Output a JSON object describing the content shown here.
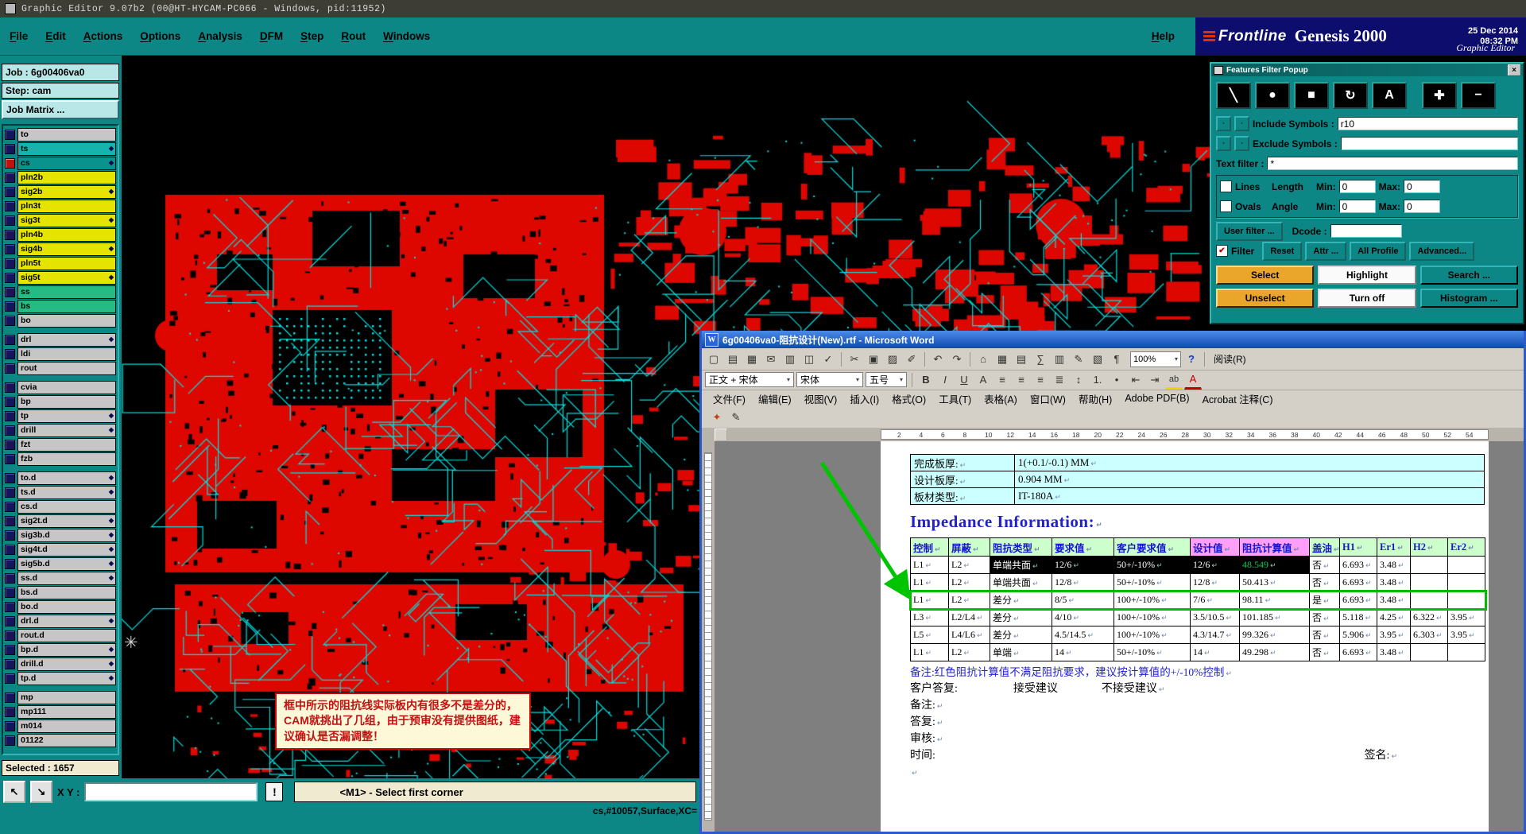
{
  "window": {
    "title": "Graphic Editor 9.07b2 (00@HT-HYCAM-PC066 - Windows, pid:11952)"
  },
  "menu": {
    "items": [
      "File",
      "Edit",
      "Actions",
      "Options",
      "Analysis",
      "DFM",
      "Step",
      "Rout",
      "Windows"
    ],
    "help": "Help"
  },
  "brand": {
    "logo": "Frontline",
    "product": "Genesis 2000",
    "date": "25 Dec 2014",
    "time": "08:32 PM",
    "subtitle": "Graphic Editor"
  },
  "pcb": {
    "origin_glyph": "✳"
  },
  "canvas_note": {
    "text": "框中所示的阻抗线实际板内有很多不是差分的，CAM就挑出了几组，由于预审没有提供图纸，建议确认是否漏调整！"
  },
  "sidebar": {
    "job_label": "Job : 6g00406va0",
    "step_label": "Step: cam",
    "matrix_button": "Job Matrix ...",
    "selected_label": "Selected : 1657",
    "marker_glyph": "◆",
    "layers": [
      {
        "name": "to",
        "color": "silver"
      },
      {
        "name": "ts",
        "color": "teal",
        "marker": true
      },
      {
        "name": "cs",
        "color": "dteal",
        "marker": true,
        "active": true
      },
      {
        "name": "pln2b",
        "color": "yellow"
      },
      {
        "name": "sig2b",
        "color": "yellow",
        "marker": true
      },
      {
        "name": "pln3t",
        "color": "yellow"
      },
      {
        "name": "sig3t",
        "color": "yellow",
        "marker": true
      },
      {
        "name": "pln4b",
        "color": "yellow"
      },
      {
        "name": "sig4b",
        "color": "yellow",
        "marker": true
      },
      {
        "name": "pln5t",
        "color": "yellow"
      },
      {
        "name": "sig5t",
        "color": "yellow",
        "marker": true
      },
      {
        "name": "ss",
        "color": "green"
      },
      {
        "name": "bs",
        "color": "green"
      },
      {
        "name": "bo",
        "color": "silver"
      },
      {
        "name": "drl",
        "color": "silver",
        "marker": true,
        "gap": true
      },
      {
        "name": "ldi",
        "color": "silver"
      },
      {
        "name": "rout",
        "color": "silver"
      },
      {
        "name": "cvia",
        "color": "silver",
        "gap": true
      },
      {
        "name": "bp",
        "color": "silver"
      },
      {
        "name": "tp",
        "color": "silver",
        "marker": true
      },
      {
        "name": "drill",
        "color": "silver",
        "marker": true
      },
      {
        "name": "fzt",
        "color": "silver"
      },
      {
        "name": "fzb",
        "color": "silver"
      },
      {
        "name": "to.d",
        "color": "silver",
        "marker": true,
        "gap": true
      },
      {
        "name": "ts.d",
        "color": "silver",
        "marker": true
      },
      {
        "name": "cs.d",
        "color": "silver"
      },
      {
        "name": "sig2t.d",
        "color": "silver",
        "marker": true
      },
      {
        "name": "sig3b.d",
        "color": "silver",
        "marker": true
      },
      {
        "name": "sig4t.d",
        "color": "silver",
        "marker": true
      },
      {
        "name": "sig5b.d",
        "color": "silver",
        "marker": true
      },
      {
        "name": "ss.d",
        "color": "silver",
        "marker": true
      },
      {
        "name": "bs.d",
        "color": "silver"
      },
      {
        "name": "bo.d",
        "color": "silver"
      },
      {
        "name": "drl.d",
        "color": "silver",
        "marker": true
      },
      {
        "name": "rout.d",
        "color": "silver"
      },
      {
        "name": "bp.d",
        "color": "silver",
        "marker": true
      },
      {
        "name": "drill.d",
        "color": "silver",
        "marker": true
      },
      {
        "name": "tp.d",
        "color": "silver",
        "marker": true
      },
      {
        "name": "mp",
        "color": "silver",
        "gap": true
      },
      {
        "name": "mp111",
        "color": "silver"
      },
      {
        "name": "m014",
        "color": "silver"
      },
      {
        "name": "01122",
        "color": "silver"
      }
    ]
  },
  "statusbar": {
    "xy_label": "X Y :",
    "xy_value": "",
    "alarm_label": "!",
    "prompt": "<M1> - Select first corner",
    "info": "cs,#10057,Surface,XC=",
    "pan_buttons": [
      {
        "name": "pan-up-left-button",
        "glyph": "↖"
      },
      {
        "name": "pan-down-right-button",
        "glyph": "↘"
      }
    ]
  },
  "ui": {
    "dropdown_arrow": "▾",
    "check_glyph": "✔",
    "close_glyph": "×",
    "word_icon": "W",
    "help_glyph": "?",
    "picker_glyph": "▪"
  },
  "filter_popup": {
    "title": "Features Filter Popup",
    "feature_buttons": [
      {
        "name": "line-feature-button",
        "glyph": "╲"
      },
      {
        "name": "pad-feature-button",
        "glyph": "●"
      },
      {
        "name": "surface-feature-button",
        "glyph": "■"
      },
      {
        "name": "arc-feature-button",
        "glyph": "↻"
      },
      {
        "name": "text-feature-button",
        "glyph": "A"
      },
      {
        "name": "positive-feature-button",
        "glyph": "✚"
      },
      {
        "name": "negative-feature-button",
        "glyph": "−"
      }
    ],
    "include_label": "Include Symbols :",
    "include_value": "r10",
    "exclude_label": "Exclude Symbols :",
    "exclude_value": "",
    "text_filter_label": "Text filter :",
    "text_filter_value": "*",
    "lines_label": "Lines",
    "length_label": "Length",
    "ovals_label": "Ovals",
    "angle_label": "Angle",
    "min_label": "Min:",
    "max_label": "Max:",
    "length_min": "0",
    "length_max": "0",
    "angle_min": "0",
    "angle_max": "0",
    "user_filter_button": "User filter ...",
    "dcode_label": "Dcode :",
    "dcode_value": "",
    "filter_check_label": "Filter",
    "reset_button": "Reset",
    "attr_button": "Attr ...",
    "profile_button": "All Profile",
    "advanced_button": "Advanced...",
    "select_button": "Select",
    "highlight_button": "Highlight",
    "search_button": "Search ...",
    "unselect_button": "Unselect",
    "turnoff_button": "Turn off",
    "histogram_button": "Histogram ..."
  },
  "word": {
    "title": "6g00406va0-阻抗设计(New).rtf - Microsoft Word",
    "zoom": "100%",
    "read_button": "阅读(R)",
    "font_style": "正文 + 宋体",
    "font_name": "宋体",
    "font_size": "五号",
    "menus": [
      {
        "label": "文件(F)",
        "key": "file"
      },
      {
        "label": "编辑(E)",
        "key": "edit"
      },
      {
        "label": "视图(V)",
        "key": "view"
      },
      {
        "label": "插入(I)",
        "key": "insert"
      },
      {
        "label": "格式(O)",
        "key": "format"
      },
      {
        "label": "工具(T)",
        "key": "tools"
      },
      {
        "label": "表格(A)",
        "key": "table"
      },
      {
        "label": "窗口(W)",
        "key": "window"
      },
      {
        "label": "帮助(H)",
        "key": "help"
      },
      {
        "label": "Adobe PDF(B)",
        "key": "adobe-pdf"
      },
      {
        "label": "Acrobat 注释(C)",
        "key": "acrobat-comments"
      }
    ],
    "toolbar1": [
      {
        "name": "new-document-icon",
        "glyph": "▢"
      },
      {
        "name": "open-icon",
        "glyph": "▤"
      },
      {
        "name": "save-icon",
        "glyph": "▦"
      },
      {
        "name": "email-icon",
        "glyph": "✉"
      },
      {
        "name": "print-icon",
        "glyph": "▥"
      },
      {
        "name": "print-preview-icon",
        "glyph": "◫"
      },
      {
        "name": "spelling-icon",
        "glyph": "✓"
      },
      {
        "name": "cut-icon",
        "glyph": "✂"
      },
      {
        "name": "copy-icon",
        "glyph": "▣"
      },
      {
        "name": "paste-icon",
        "glyph": "▨"
      },
      {
        "name": "format-painter-icon",
        "glyph": "✐"
      },
      {
        "name": "undo-icon",
        "glyph": "↶"
      },
      {
        "name": "redo-icon",
        "glyph": "↷"
      },
      {
        "name": "hyperlink-icon",
        "glyph": "⌂"
      },
      {
        "name": "tables-borders-icon",
        "glyph": "▦"
      },
      {
        "name": "insert-table-icon",
        "glyph": "▤"
      },
      {
        "name": "insert-excel-icon",
        "glyph": "∑"
      },
      {
        "name": "columns-icon",
        "glyph": "▥"
      },
      {
        "name": "drawing-icon",
        "glyph": "✎"
      },
      {
        "name": "document-map-icon",
        "glyph": "▧"
      },
      {
        "name": "show-marks-icon",
        "glyph": "¶"
      }
    ],
    "toolbar2": [
      {
        "name": "bold-button",
        "glyph": "B"
      },
      {
        "name": "italic-button",
        "glyph": "I"
      },
      {
        "name": "underline-button",
        "glyph": "U"
      },
      {
        "name": "char-border-button",
        "glyph": "A"
      },
      {
        "name": "align-left-button",
        "glyph": "≡"
      },
      {
        "name": "align-center-button",
        "glyph": "≡"
      },
      {
        "name": "align-right-button",
        "glyph": "≡"
      },
      {
        "name": "justify-button",
        "glyph": "≣"
      },
      {
        "name": "line-spacing-button",
        "glyph": "↕"
      },
      {
        "name": "numbered-list-button",
        "glyph": "1."
      },
      {
        "name": "bulleted-list-button",
        "glyph": "•"
      },
      {
        "name": "outdent-button",
        "glyph": "⇤"
      },
      {
        "name": "indent-button",
        "glyph": "⇥"
      },
      {
        "name": "highlight-button",
        "glyph": "ab"
      },
      {
        "name": "font-color-button",
        "glyph": "A"
      }
    ],
    "iconrow": [
      {
        "name": "permission-icon",
        "glyph": "✦"
      },
      {
        "name": "pen-icon",
        "glyph": "✎"
      }
    ],
    "ruler_numbers": [
      2,
      4,
      6,
      8,
      10,
      12,
      14,
      16,
      18,
      20,
      22,
      24,
      26,
      28,
      30,
      32,
      34,
      36,
      38,
      40,
      42,
      44,
      46,
      48,
      50,
      52,
      54
    ],
    "info_rows": [
      {
        "label": "完成板厚:",
        "value": "1(+0.1/-0.1) MM"
      },
      {
        "label": "设计板厚:",
        "value": "0.904 MM"
      },
      {
        "label": "板材类型:",
        "value": "IT-180A"
      }
    ],
    "heading": "Impedance Information:",
    "table": {
      "headers": [
        "控制",
        "屏蔽",
        "阻抗类型",
        "要求值",
        "客户要求值",
        "设计值",
        "阻抗计算值",
        "盖油",
        "H1",
        "Er1",
        "H2",
        "Er2"
      ],
      "rows": [
        [
          "L1",
          "L2",
          "单端共面",
          "12/6",
          "50+/-10%",
          "12/6",
          "48.549",
          "否",
          "6.693",
          "3.48",
          "",
          ""
        ],
        [
          "L1",
          "L2",
          "单端共面",
          "12/8",
          "50+/-10%",
          "12/8",
          "50.413",
          "否",
          "6.693",
          "3.48",
          "",
          ""
        ],
        [
          "L1",
          "L2",
          "差分",
          "8/5",
          "100+/-10%",
          "7/6",
          "98.11",
          "是",
          "6.693",
          "3.48",
          "",
          ""
        ],
        [
          "L3",
          "L2/L4",
          "差分",
          "4/10",
          "100+/-10%",
          "3.5/10.5",
          "101.185",
          "否",
          "5.118",
          "4.25",
          "6.322",
          "3.95"
        ],
        [
          "L5",
          "L4/L6",
          "差分",
          "4.5/14.5",
          "100+/-10%",
          "4.3/14.7",
          "99.326",
          "否",
          "5.906",
          "3.95",
          "6.303",
          "3.95"
        ],
        [
          "L1",
          "L2",
          "单端",
          "14",
          "50+/-10%",
          "14",
          "49.298",
          "否",
          "6.693",
          "3.48",
          "",
          ""
        ]
      ]
    },
    "note_line": "备注:红色阻抗计算值不满足阻抗要求，建议按计算值的+/-10%控制",
    "reply_label": "客户答复:",
    "accept_label": "接受建议",
    "reject_label": "不接受建议",
    "remark_label": "备注:",
    "answer_label": "答复:",
    "audit_label": "审核:",
    "time_label": "时间:",
    "sign_label": "签名:",
    "pilcrow": "↵"
  }
}
